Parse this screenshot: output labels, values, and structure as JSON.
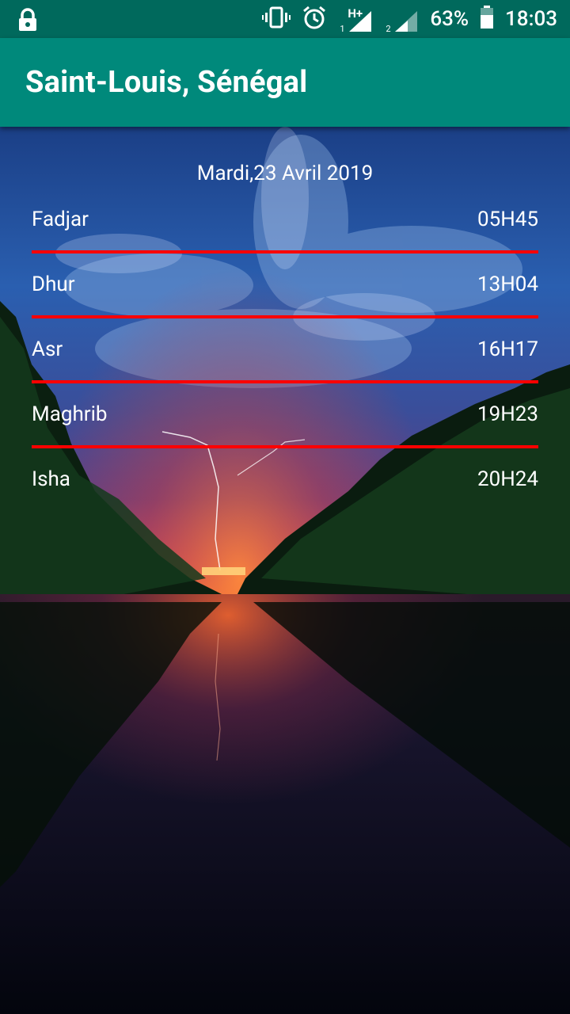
{
  "status_bar": {
    "network_label": "H+",
    "sim1": "1",
    "sim2": "2",
    "battery": "63%",
    "time": "18:03"
  },
  "app_bar": {
    "title": "Saint-Louis, Sénégal"
  },
  "date": "Mardi,23 Avril 2019",
  "prayers": [
    {
      "name": "Fadjar",
      "time": "05H45"
    },
    {
      "name": "Dhur",
      "time": "13H04"
    },
    {
      "name": "Asr",
      "time": "16H17"
    },
    {
      "name": "Maghrib",
      "time": "19H23"
    },
    {
      "name": "Isha",
      "time": "20H24"
    }
  ],
  "colors": {
    "status_bar": "#00695c",
    "app_bar": "#00897b",
    "divider": "#ff0000",
    "text": "#ffffff"
  }
}
